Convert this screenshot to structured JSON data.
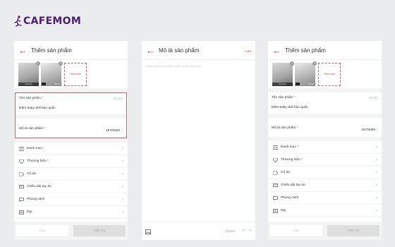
{
  "brand": {
    "name": "CAFEMOM",
    "color": "#4a1f6e"
  },
  "colors": {
    "accent": "#e2333a",
    "highlight_border": "#e05a5a"
  },
  "screens": [
    {
      "header": {
        "title": "Thêm sản phẩm"
      },
      "images": [
        {
          "caption": "Ảnh bìa"
        },
        {
          "duration": "00:10"
        }
      ],
      "add_image_label": "Thêm ảnh",
      "name_field": {
        "label": "Tên sản phẩm",
        "required": "*",
        "counter": "20/120",
        "value": "Đầm baby doll hàn quốc"
      },
      "desc_field": {
        "label": "Mô tả sản phẩm",
        "required": "*",
        "counter": "197/5000"
      },
      "menu": [
        {
          "label": "Danh mục",
          "required": "*",
          "icon": "list-icon"
        },
        {
          "label": "Thương hiệu",
          "required": "*",
          "icon": "diamond-icon"
        },
        {
          "label": "Cổ áo",
          "required": "",
          "icon": "tag-icon"
        },
        {
          "label": "Chiều dài tay áo",
          "required": "",
          "icon": "message-icon"
        },
        {
          "label": "Phong cách",
          "required": "",
          "icon": "chat-icon"
        },
        {
          "label": "Dịp",
          "required": "",
          "icon": "document-icon"
        }
      ],
      "footer": {
        "save": "Lưu",
        "done": "Hiển thị"
      }
    },
    {
      "header": {
        "title": "Mô tả sản phẩm",
        "action": "Lưu"
      },
      "placeholder": "Nhập mô tả sản phẩm ngắn và dễ hiểu nhất",
      "footer": {
        "counter": "0/5000"
      }
    },
    {
      "header": {
        "title": "Thêm sản phẩm"
      },
      "images": [
        {
          "caption": "Ảnh bìa"
        },
        {
          "duration": "00:10"
        }
      ],
      "add_image_label": "Thêm ảnh",
      "name_field": {
        "label": "Tên sản phẩm",
        "required": "*",
        "counter": "20/120",
        "value": "Đầm baby doll hàn quốc"
      },
      "desc_field": {
        "label": "Mô tả sản phẩm",
        "required": "*",
        "counter": "197/5000"
      },
      "menu": [
        {
          "label": "Danh mục",
          "required": "*",
          "icon": "list-icon"
        },
        {
          "label": "Thương hiệu",
          "required": "*",
          "icon": "diamond-icon"
        },
        {
          "label": "Cổ áo",
          "required": "",
          "icon": "tag-icon"
        },
        {
          "label": "Chiều dài tay áo",
          "required": "",
          "icon": "message-icon"
        },
        {
          "label": "Phong cách",
          "required": "",
          "icon": "chat-icon"
        },
        {
          "label": "Dịp",
          "required": "",
          "icon": "document-icon"
        }
      ],
      "footer": {
        "save": "Lưu",
        "done": "Hiển thị"
      }
    }
  ]
}
